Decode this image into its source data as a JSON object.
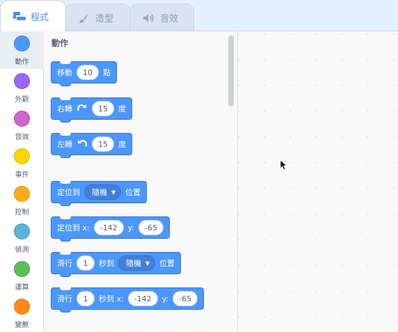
{
  "tabs": [
    {
      "label": "程式",
      "icon": "code-icon",
      "active": true
    },
    {
      "label": "造型",
      "icon": "brush-icon",
      "active": false
    },
    {
      "label": "音效",
      "icon": "speaker-icon",
      "active": false
    }
  ],
  "categories": [
    {
      "label": "動作",
      "color": "#4c97ff",
      "selected": true
    },
    {
      "label": "外觀",
      "color": "#9966ff",
      "selected": false
    },
    {
      "label": "音效",
      "color": "#cf63cf",
      "selected": false
    },
    {
      "label": "事件",
      "color": "#ffd500",
      "selected": false
    },
    {
      "label": "控制",
      "color": "#ffab19",
      "selected": false
    },
    {
      "label": "偵測",
      "color": "#5cb1d6",
      "selected": false
    },
    {
      "label": "運算",
      "color": "#59c059",
      "selected": false
    },
    {
      "label": "變數",
      "color": "#ff8c1a",
      "selected": false
    }
  ],
  "palette": {
    "title": "動作",
    "blocks": {
      "move": {
        "text1": "移動",
        "value": "10",
        "text2": "點"
      },
      "turn_right": {
        "text1": "右轉",
        "value": "15",
        "text2": "度"
      },
      "turn_left": {
        "text1": "左轉",
        "value": "15",
        "text2": "度"
      },
      "goto": {
        "text1": "定位到",
        "dropdown": "隨機",
        "text2": "位置"
      },
      "goto_xy": {
        "text1": "定位到 x:",
        "x": "-142",
        "text2": "y:",
        "y": "-65"
      },
      "glide": {
        "text1": "滑行",
        "secs": "1",
        "text2": "秒到",
        "dropdown": "隨機",
        "text3": "位置"
      },
      "glide_xy": {
        "text1": "滑行",
        "secs": "1",
        "text2": "秒到 x:",
        "x": "-142",
        "text3": "y:",
        "y": "-65"
      }
    }
  },
  "colors": {
    "accent": "#4c97ff",
    "active_tab_text": "#4c8bf5"
  }
}
